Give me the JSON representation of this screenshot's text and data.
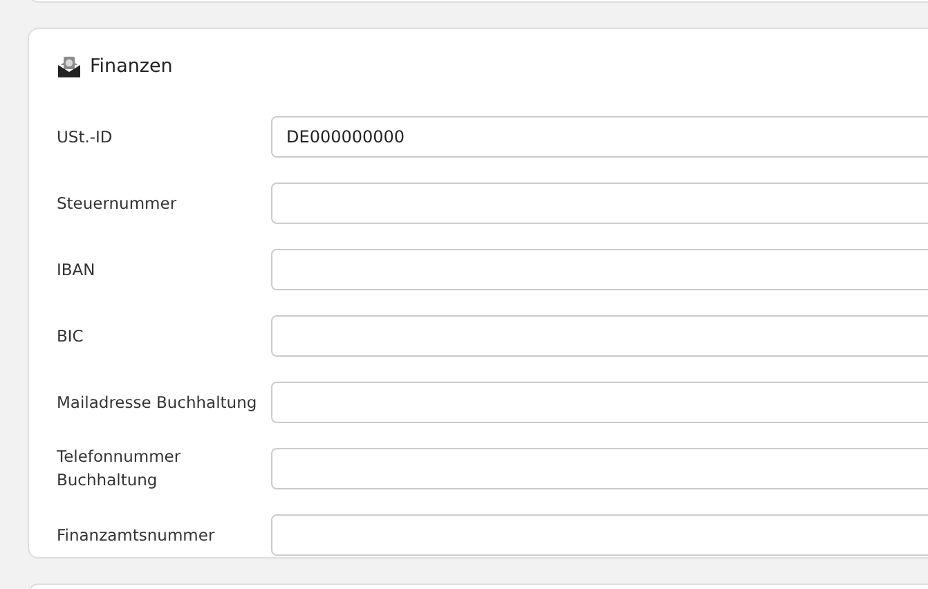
{
  "section": {
    "title": "Finanzen"
  },
  "fields": [
    {
      "label": "USt.-ID",
      "value": "DE000000000"
    },
    {
      "label": "Steuernummer"
    },
    {
      "label": "IBAN"
    },
    {
      "label": "BIC"
    },
    {
      "label": "Mailadresse Buchhaltung"
    },
    {
      "label": "Telefonnummer Buchhaltung"
    },
    {
      "label": "Finanzamtsnummer"
    }
  ]
}
